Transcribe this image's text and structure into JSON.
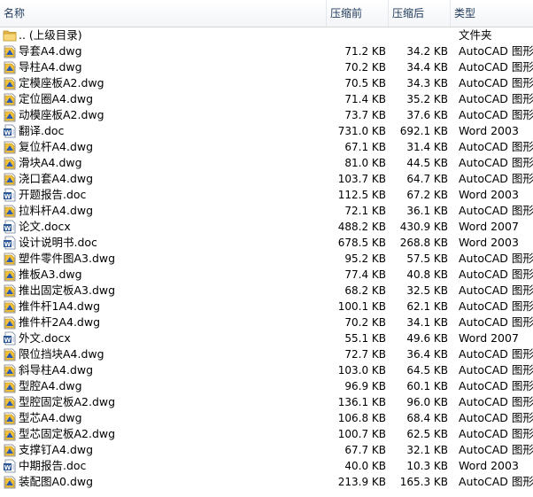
{
  "header": {
    "name": "名称",
    "original_size": "压缩前",
    "compressed_size": "压缩后",
    "type": "类型"
  },
  "rows": [
    {
      "name": ".. (上级目录)",
      "original": "",
      "compressed": "",
      "type": "文件夹",
      "icon": "folder-icon"
    },
    {
      "name": "导套A4.dwg",
      "original": "71.2 KB",
      "compressed": "34.2 KB",
      "type": "AutoCAD 图形",
      "icon": "dwg-file-icon"
    },
    {
      "name": "导柱A4.dwg",
      "original": "70.2 KB",
      "compressed": "34.4 KB",
      "type": "AutoCAD 图形",
      "icon": "dwg-file-icon"
    },
    {
      "name": "定模座板A2.dwg",
      "original": "70.5 KB",
      "compressed": "34.3 KB",
      "type": "AutoCAD 图形",
      "icon": "dwg-file-icon"
    },
    {
      "name": "定位圈A4.dwg",
      "original": "71.4 KB",
      "compressed": "35.2 KB",
      "type": "AutoCAD 图形",
      "icon": "dwg-file-icon"
    },
    {
      "name": "动模座板A2.dwg",
      "original": "73.7 KB",
      "compressed": "37.6 KB",
      "type": "AutoCAD 图形",
      "icon": "dwg-file-icon"
    },
    {
      "name": "翻译.doc",
      "original": "731.0 KB",
      "compressed": "692.1 KB",
      "type": "Word 2003",
      "icon": "word-doc-icon"
    },
    {
      "name": "复位杆A4.dwg",
      "original": "67.1 KB",
      "compressed": "31.4 KB",
      "type": "AutoCAD 图形",
      "icon": "dwg-file-icon"
    },
    {
      "name": "滑块A4.dwg",
      "original": "81.0 KB",
      "compressed": "44.5 KB",
      "type": "AutoCAD 图形",
      "icon": "dwg-file-icon"
    },
    {
      "name": "浇口套A4.dwg",
      "original": "103.7 KB",
      "compressed": "64.7 KB",
      "type": "AutoCAD 图形",
      "icon": "dwg-file-icon"
    },
    {
      "name": "开题报告.doc",
      "original": "112.5 KB",
      "compressed": "67.2 KB",
      "type": "Word 2003",
      "icon": "word-doc-icon"
    },
    {
      "name": "拉料杆A4.dwg",
      "original": "72.1 KB",
      "compressed": "36.1 KB",
      "type": "AutoCAD 图形",
      "icon": "dwg-file-icon"
    },
    {
      "name": "论文.docx",
      "original": "488.2 KB",
      "compressed": "430.9 KB",
      "type": "Word 2007",
      "icon": "word-doc-icon"
    },
    {
      "name": "设计说明书.doc",
      "original": "678.5 KB",
      "compressed": "268.8 KB",
      "type": "Word 2003",
      "icon": "word-doc-icon"
    },
    {
      "name": "塑件零件图A3.dwg",
      "original": "95.2 KB",
      "compressed": "57.5 KB",
      "type": "AutoCAD 图形",
      "icon": "dwg-file-icon"
    },
    {
      "name": "推板A3.dwg",
      "original": "77.4 KB",
      "compressed": "40.8 KB",
      "type": "AutoCAD 图形",
      "icon": "dwg-file-icon"
    },
    {
      "name": "推出固定板A3.dwg",
      "original": "68.2 KB",
      "compressed": "32.5 KB",
      "type": "AutoCAD 图形",
      "icon": "dwg-file-icon"
    },
    {
      "name": "推件杆1A4.dwg",
      "original": "100.1 KB",
      "compressed": "62.1 KB",
      "type": "AutoCAD 图形",
      "icon": "dwg-file-icon"
    },
    {
      "name": "推件杆2A4.dwg",
      "original": "70.2 KB",
      "compressed": "34.1 KB",
      "type": "AutoCAD 图形",
      "icon": "dwg-file-icon"
    },
    {
      "name": "外文.docx",
      "original": "55.1 KB",
      "compressed": "49.6 KB",
      "type": "Word 2007",
      "icon": "word-doc-icon"
    },
    {
      "name": "限位挡块A4.dwg",
      "original": "72.7 KB",
      "compressed": "36.4 KB",
      "type": "AutoCAD 图形",
      "icon": "dwg-file-icon"
    },
    {
      "name": "斜导柱A4.dwg",
      "original": "103.0 KB",
      "compressed": "64.5 KB",
      "type": "AutoCAD 图形",
      "icon": "dwg-file-icon"
    },
    {
      "name": "型腔A4.dwg",
      "original": "96.9 KB",
      "compressed": "60.1 KB",
      "type": "AutoCAD 图形",
      "icon": "dwg-file-icon"
    },
    {
      "name": "型腔固定板A2.dwg",
      "original": "136.1 KB",
      "compressed": "96.0 KB",
      "type": "AutoCAD 图形",
      "icon": "dwg-file-icon"
    },
    {
      "name": "型芯A4.dwg",
      "original": "106.8 KB",
      "compressed": "68.4 KB",
      "type": "AutoCAD 图形",
      "icon": "dwg-file-icon"
    },
    {
      "name": "型芯固定板A2.dwg",
      "original": "100.7 KB",
      "compressed": "62.5 KB",
      "type": "AutoCAD 图形",
      "icon": "dwg-file-icon"
    },
    {
      "name": "支撑钉A4.dwg",
      "original": "67.7 KB",
      "compressed": "32.1 KB",
      "type": "AutoCAD 图形",
      "icon": "dwg-file-icon"
    },
    {
      "name": "中期报告.doc",
      "original": "40.0 KB",
      "compressed": "10.3 KB",
      "type": "Word 2003",
      "icon": "word-doc-icon"
    },
    {
      "name": "装配图A0.dwg",
      "original": "213.9 KB",
      "compressed": "165.3 KB",
      "type": "AutoCAD 图形",
      "icon": "dwg-file-icon"
    }
  ]
}
